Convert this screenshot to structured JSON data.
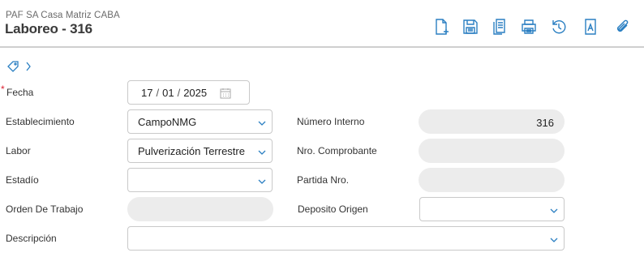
{
  "header": {
    "company": "PAF SA Casa Matriz CABA",
    "title": "Laboreo - 316"
  },
  "toolbar": {
    "icons": [
      "new-document-icon",
      "save-icon",
      "copy-icon",
      "print-icon",
      "history-icon",
      "document-text-icon",
      "attachment-icon"
    ]
  },
  "colors": {
    "accent": "#2a7fc2",
    "required": "#dd2233"
  },
  "form": {
    "fecha": {
      "label": "Fecha",
      "required_mark": "*",
      "day": "17",
      "month": "01",
      "year": "2025",
      "sep": "/"
    },
    "establecimiento": {
      "label": "Establecimiento",
      "value": "CampoNMG"
    },
    "numero_interno": {
      "label": "Número Interno",
      "value": "316"
    },
    "labor": {
      "label": "Labor",
      "value": "Pulverización Terrestre"
    },
    "nro_comprobante": {
      "label": "Nro. Comprobante",
      "value": ""
    },
    "estadio": {
      "label": "Estadío",
      "value": ""
    },
    "partida_nro": {
      "label": "Partida Nro.",
      "value": ""
    },
    "orden_de_trabajo": {
      "label": "Orden De Trabajo",
      "value": ""
    },
    "deposito_origen": {
      "label": "Deposito Origen",
      "value": ""
    },
    "descripcion": {
      "label": "Descripción",
      "value": ""
    }
  }
}
